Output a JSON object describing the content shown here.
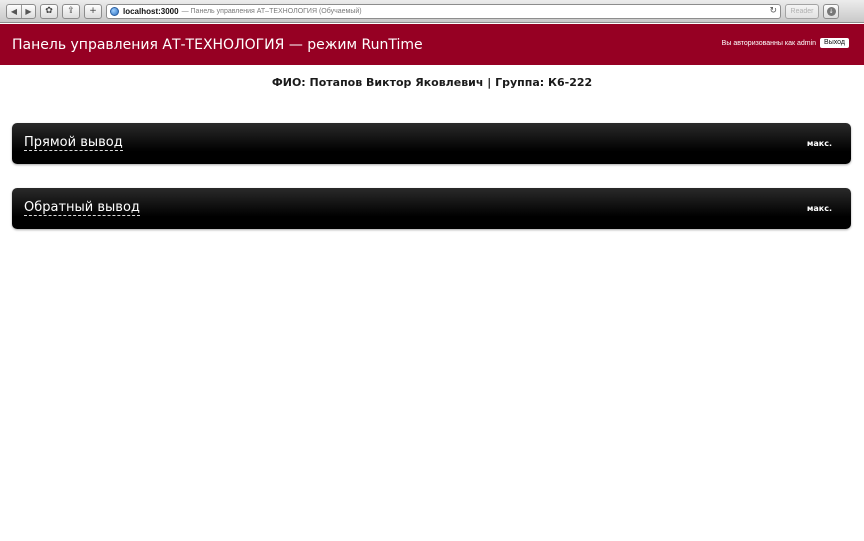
{
  "browser": {
    "back_glyph": "◀",
    "forward_glyph": "▶",
    "history_glyph": "✿",
    "share_glyph": "⇪",
    "add_glyph": "+",
    "url_host": "localhost:3000",
    "url_title": "— Панель управления АТ–ТЕХНОЛОГИЯ (Обучаемый)",
    "reload_glyph": "↻",
    "reader_label": "Reader",
    "download_glyph": "↓"
  },
  "header": {
    "title": "Панель управления АТ-ТЕХНОЛОГИЯ — режим RunTime",
    "auth_text": "Вы авторизованны как admin",
    "logout_label": "Выход",
    "background": "#960023"
  },
  "student": {
    "line": "ФИО: Потапов Виктор Яковлевич | Группа: К6-222"
  },
  "panels": [
    {
      "title": "Прямой вывод",
      "max_label": "макс."
    },
    {
      "title": "Обратный вывод",
      "max_label": "макс."
    }
  ]
}
